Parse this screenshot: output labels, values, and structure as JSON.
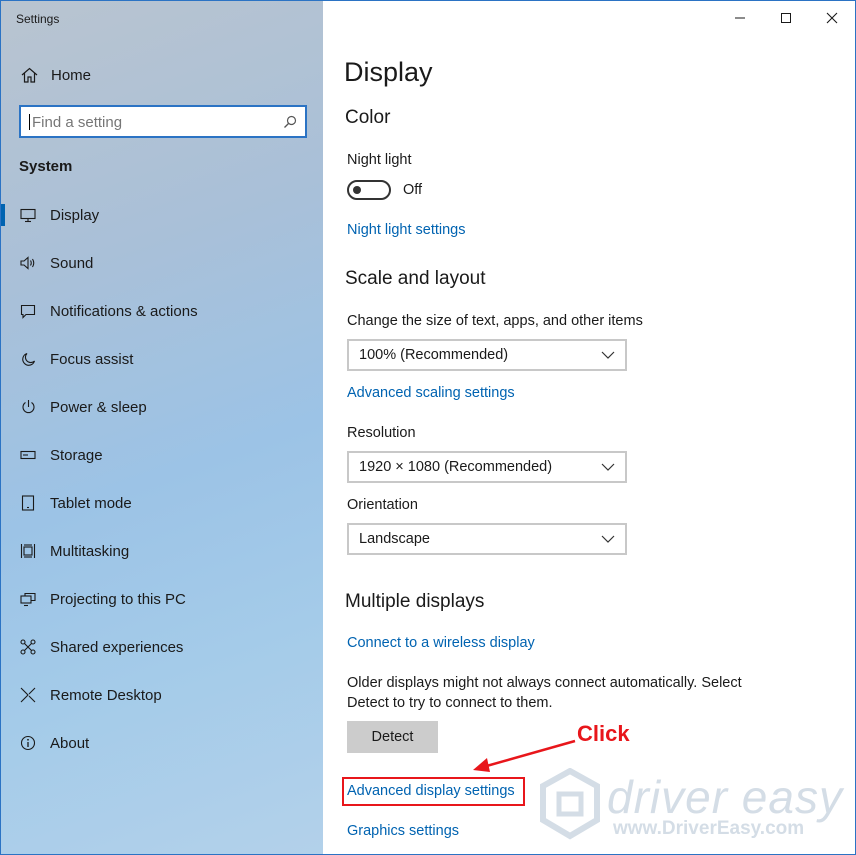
{
  "window": {
    "title": "Settings",
    "controls": {
      "minimize": "minimize-icon",
      "maximize": "maximize-icon",
      "close": "close-icon"
    }
  },
  "sidebar": {
    "home_label": "Home",
    "search_placeholder": "Find a setting",
    "section_label": "System",
    "items": [
      {
        "label": "Display",
        "icon": "monitor-icon",
        "active": true
      },
      {
        "label": "Sound",
        "icon": "speaker-icon"
      },
      {
        "label": "Notifications & actions",
        "icon": "message-icon"
      },
      {
        "label": "Focus assist",
        "icon": "moon-icon"
      },
      {
        "label": "Power & sleep",
        "icon": "power-icon"
      },
      {
        "label": "Storage",
        "icon": "drive-icon"
      },
      {
        "label": "Tablet mode",
        "icon": "tablet-icon"
      },
      {
        "label": "Multitasking",
        "icon": "multitask-icon"
      },
      {
        "label": "Projecting to this PC",
        "icon": "project-icon"
      },
      {
        "label": "Shared experiences",
        "icon": "share-icon"
      },
      {
        "label": "Remote Desktop",
        "icon": "remote-icon"
      },
      {
        "label": "About",
        "icon": "info-icon"
      }
    ]
  },
  "main": {
    "title": "Display",
    "color": {
      "heading": "Color",
      "night_light_label": "Night light",
      "night_light_state": "Off",
      "night_light_settings_link": "Night light settings"
    },
    "scale": {
      "heading": "Scale and layout",
      "size_label": "Change the size of text, apps, and other items",
      "size_value": "100% (Recommended)",
      "advanced_scaling_link": "Advanced scaling settings",
      "resolution_label": "Resolution",
      "resolution_value": "1920 × 1080 (Recommended)",
      "orientation_label": "Orientation",
      "orientation_value": "Landscape"
    },
    "multiple": {
      "heading": "Multiple displays",
      "wireless_link": "Connect to a wireless display",
      "note_line1": "Older displays might not always connect automatically. Select",
      "note_line2": "Detect to try to connect to them.",
      "detect_button": "Detect",
      "advanced_display_link": "Advanced display settings",
      "graphics_link": "Graphics settings"
    },
    "annotation": {
      "label": "Click",
      "color": "#e8161b"
    },
    "watermark": {
      "brand": "driver easy",
      "url": "www.DriverEasy.com"
    }
  },
  "colors": {
    "accent": "#0063b1",
    "annotation": "#e8161b"
  }
}
